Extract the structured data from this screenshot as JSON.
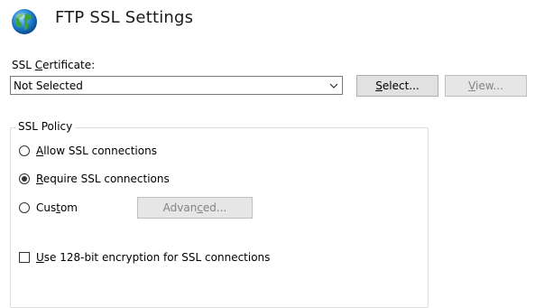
{
  "header": {
    "title": "FTP SSL Settings",
    "icon": "globe-icon"
  },
  "certificate": {
    "label": "SSL Certificate:",
    "selected_value": "Not Selected",
    "select_button": "Select...",
    "view_button": "View..."
  },
  "policy": {
    "group_label": "SSL Policy",
    "options": [
      {
        "label": "Allow SSL connections",
        "checked": false
      },
      {
        "label": "Require SSL connections",
        "checked": true
      },
      {
        "label": "Custom",
        "checked": false
      }
    ],
    "advanced_button": "Advanced...",
    "encryption_checkbox_label": "Use 128-bit encryption for SSL connections",
    "encryption_checked": false
  },
  "colors": {
    "button_face": "#e1e1e1",
    "disabled_text": "#838383",
    "border": "#7a7a7a"
  }
}
